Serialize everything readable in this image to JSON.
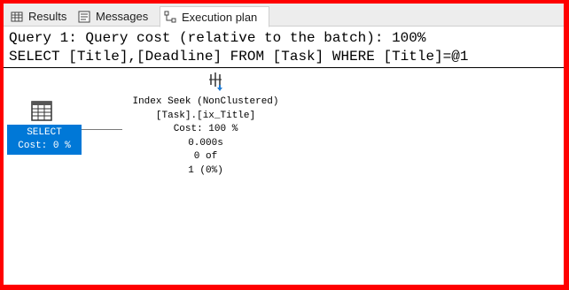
{
  "tabs": [
    {
      "label": "Results",
      "icon": "grid-icon",
      "active": false
    },
    {
      "label": "Messages",
      "icon": "messages-icon",
      "active": false
    },
    {
      "label": "Execution plan",
      "icon": "execution-plan-icon",
      "active": true
    }
  ],
  "query": {
    "header": "Query 1: Query cost (relative to the batch): 100%",
    "sql": "SELECT [Title],[Deadline] FROM [Task] WHERE [Title]=@1"
  },
  "plan": {
    "select_node": {
      "line1": "SELECT",
      "line2": "Cost: 0 %",
      "icon": "select-result-icon",
      "highlight_color": "#0078d7"
    },
    "seek_node": {
      "icon": "index-seek-icon",
      "operator": "Index Seek (NonClustered)",
      "object": "[Task].[ix_Title]",
      "cost": "Cost: 100 %",
      "time": "0.000s",
      "rows": "0 of",
      "estimate": "1 (0%)"
    }
  },
  "colors": {
    "frame": "#ff0000",
    "tab_strip": "#ededed"
  }
}
